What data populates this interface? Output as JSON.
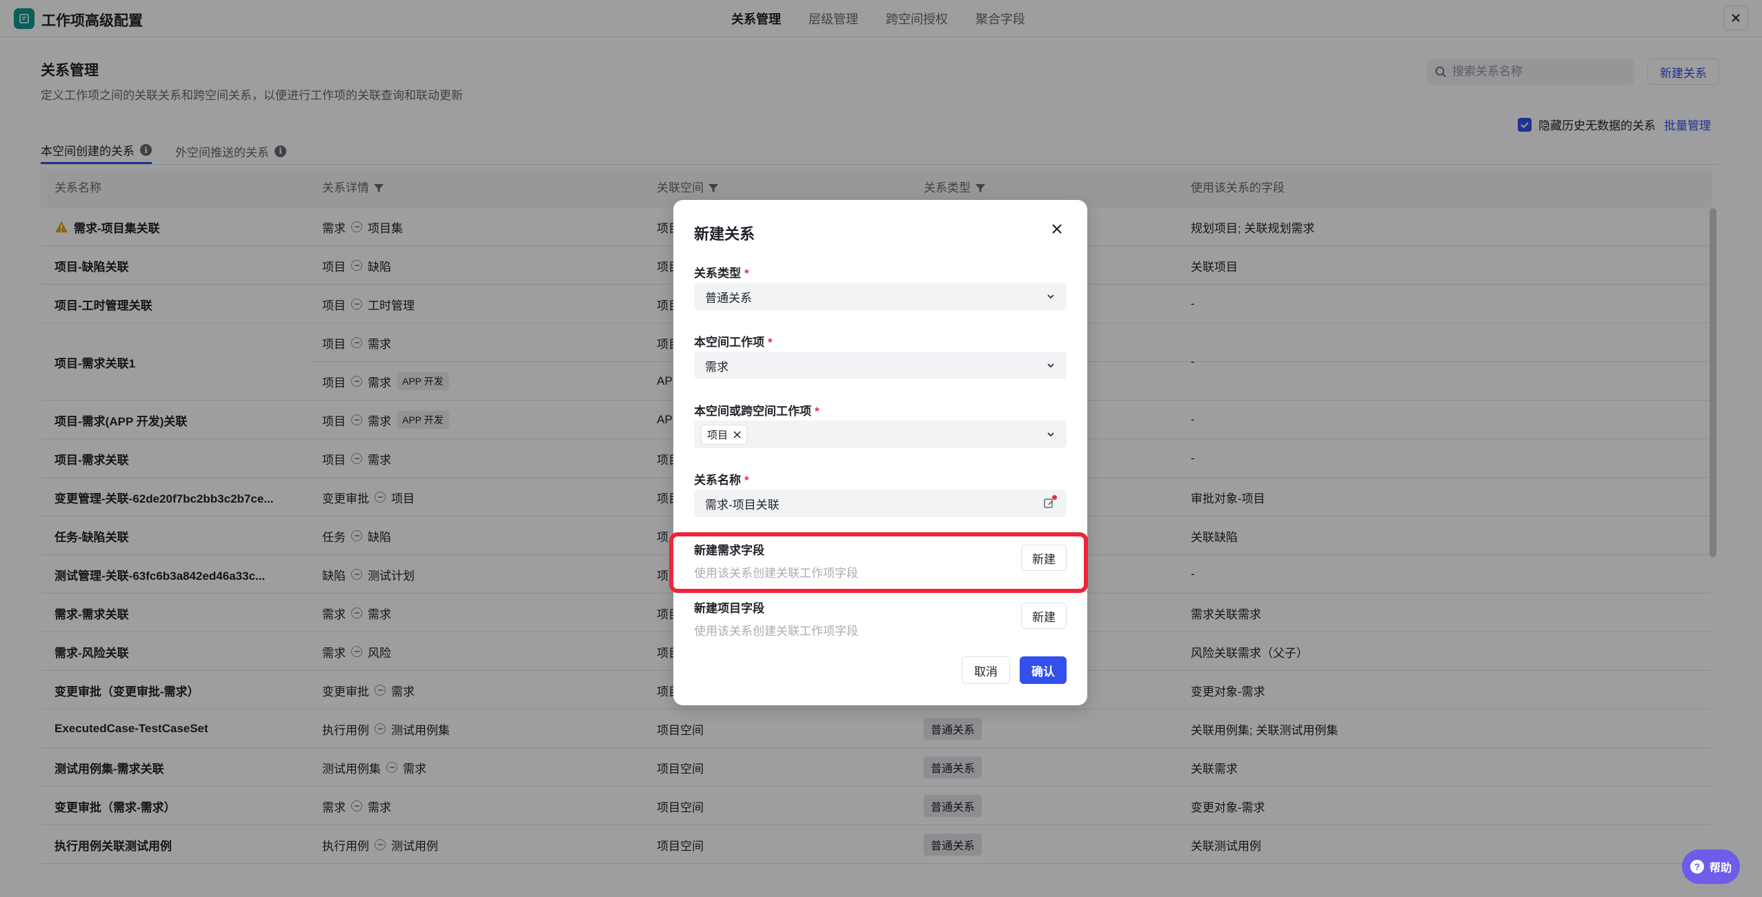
{
  "app": {
    "title": "工作项高级配置"
  },
  "top_tabs": [
    {
      "label": "关系管理",
      "active": true
    },
    {
      "label": "层级管理",
      "active": false
    },
    {
      "label": "跨空间授权",
      "active": false
    },
    {
      "label": "聚合字段",
      "active": false
    }
  ],
  "page": {
    "title": "关系管理",
    "description": "定义工作项之间的关联关系和跨空间关系，以便进行工作项的关联查询和联动更新",
    "search_placeholder": "搜索关系名称",
    "new_relation_label": "新建关系",
    "hide_history_label": "隐藏历史无数据的关系",
    "batch_manage_label": "批量管理"
  },
  "sub_tabs": [
    {
      "label": "本空间创建的关系",
      "active": true
    },
    {
      "label": "外空间推送的关系",
      "active": false
    }
  ],
  "table": {
    "columns": [
      "关系名称",
      "关系详情",
      "关联空间",
      "关系类型",
      "使用该关系的字段"
    ],
    "rows": [
      {
        "name": "需求-项目集关联",
        "warn": true,
        "from": "需求",
        "to": "项目集",
        "space": "项目",
        "type": "",
        "fields": "规划项目; 关联规划需求"
      },
      {
        "name": "项目-缺陷关联",
        "from": "项目",
        "to": "缺陷",
        "space": "项目",
        "type": "",
        "fields": "关联项目"
      },
      {
        "name": "项目-工时管理关联",
        "from": "项目",
        "to": "工时管理",
        "space": "项目",
        "type": "",
        "fields": "-"
      },
      {
        "name": "项目-需求关联1",
        "tall": true,
        "from": "项目",
        "to": "需求",
        "space": "项目",
        "from2": "项目",
        "to2": "需求",
        "tag2": "APP 开发",
        "space2": "AP",
        "type": "",
        "fields": "-"
      },
      {
        "name": "项目-需求(APP 开发)关联",
        "from": "项目",
        "to": "需求",
        "tag": "APP 开发",
        "space": "AP",
        "type": "",
        "fields": "-"
      },
      {
        "name": "项目-需求关联",
        "from": "项目",
        "to": "需求",
        "space": "项目",
        "type": "",
        "fields": "-"
      },
      {
        "name": "变更管理-关联-62de20f7bc2bb3c2b7ce...",
        "from": "变更审批",
        "to": "项目",
        "space": "项目",
        "type": "",
        "fields": "审批对象-项目"
      },
      {
        "name": "任务-缺陷关联",
        "from": "任务",
        "to": "缺陷",
        "space": "项",
        "type": "",
        "fields": "关联缺陷"
      },
      {
        "name": "测试管理-关联-63fc6b3a842ed46a33c...",
        "from": "缺陷",
        "to": "测试计划",
        "space": "项",
        "type": "",
        "fields": "-"
      },
      {
        "name": "需求-需求关联",
        "from": "需求",
        "to": "需求",
        "space": "项目",
        "type": "",
        "fields": "需求关联需求"
      },
      {
        "name": "需求-风险关联",
        "from": "需求",
        "to": "风险",
        "space": "项目",
        "type": "",
        "fields": "风险关联需求（父子）"
      },
      {
        "name": "变更审批（变更审批-需求）",
        "from": "变更审批",
        "to": "需求",
        "space": "项目",
        "type": "",
        "fields": "变更对象-需求"
      },
      {
        "name": "ExecutedCase-TestCaseSet",
        "from": "执行用例",
        "to": "测试用例集",
        "space": "项目空间",
        "type": "普通关系",
        "fields": "关联用例集; 关联测试用例集"
      },
      {
        "name": "测试用例集-需求关联",
        "from": "测试用例集",
        "to": "需求",
        "space": "项目空间",
        "type": "普通关系",
        "fields": "关联需求"
      },
      {
        "name": "变更审批（需求-需求）",
        "from": "需求",
        "to": "需求",
        "space": "项目空间",
        "type": "普通关系",
        "fields": "变更对象-需求"
      },
      {
        "name": "执行用例关联测试用例",
        "from": "执行用例",
        "to": "测试用例",
        "space": "项目空间",
        "type": "普通关系",
        "fields": "关联测试用例"
      }
    ]
  },
  "modal": {
    "title": "新建关系",
    "relation_type_label": "关系类型",
    "relation_type_value": "普通关系",
    "local_item_label": "本空间工作项",
    "local_item_value": "需求",
    "target_item_label": "本空间或跨空间工作项",
    "target_item_chip": "项目",
    "relation_name_label": "关系名称",
    "relation_name_value": "需求-项目关联",
    "option1_title": "新建需求字段",
    "option1_desc": "使用该关系创建关联工作项字段",
    "option1_btn": "新建",
    "option2_title": "新建项目字段",
    "option2_desc": "使用该关系创建关联工作项字段",
    "option2_btn": "新建",
    "cancel_label": "取消",
    "confirm_label": "确认"
  },
  "help": {
    "label": "帮助"
  },
  "colors": {
    "accent": "#3250eb",
    "highlight": "#f0233a",
    "logo": "#0f9b8e",
    "help": "#6d5de9"
  }
}
